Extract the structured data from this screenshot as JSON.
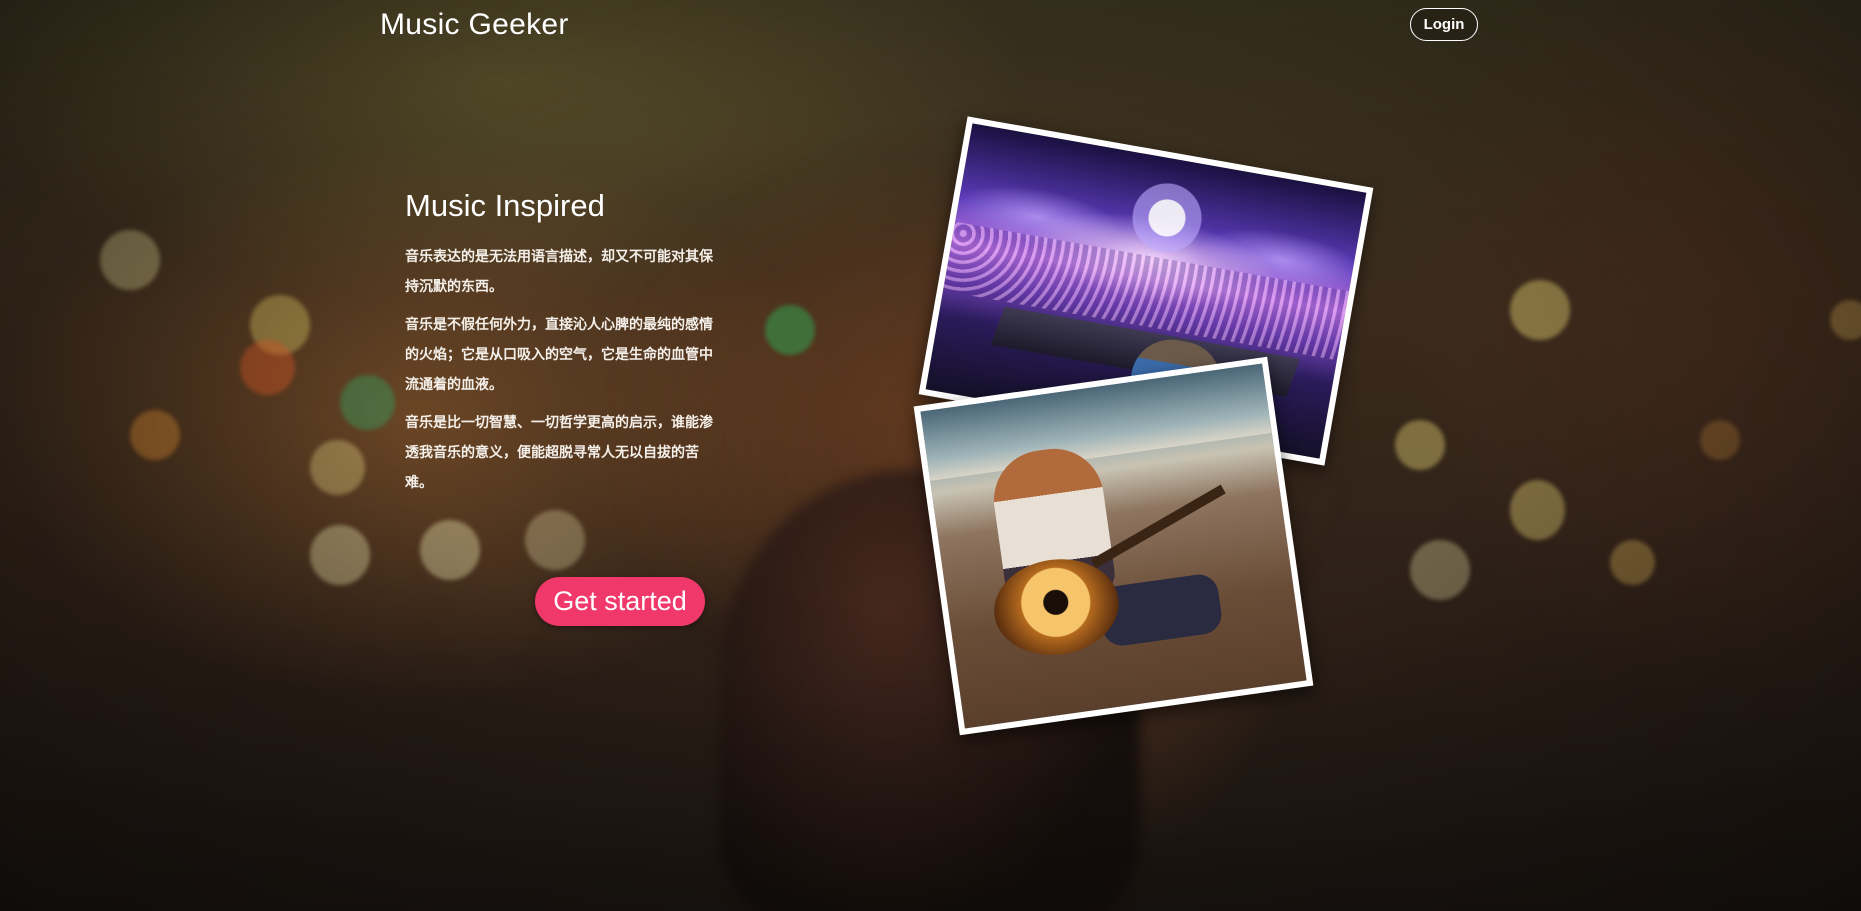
{
  "header": {
    "brand": "Music Geeker",
    "login_label": "Login"
  },
  "hero": {
    "title": "Music Inspired",
    "paragraphs": [
      "音乐表达的是无法用语言描述，却又不可能对其保持沉默的东西。",
      "音乐是不假任何外力，直接沁人心脾的最纯的感情的火焰；它是从口吸入的空气，它是生命的血管中流通着的血液。",
      "音乐是比一切智慧、一切哲学更高的启示，谁能渗透我音乐的意义，便能超脱寻常人无以自拔的苦难。"
    ],
    "cta_label": "Get started"
  },
  "colors": {
    "accent": "#f0386b",
    "text": "#ffffff"
  },
  "images": [
    {
      "name": "concert-photo",
      "description_icon": "dj-concert-image"
    },
    {
      "name": "guitar-photo",
      "description_icon": "woman-playing-guitar-image"
    }
  ]
}
